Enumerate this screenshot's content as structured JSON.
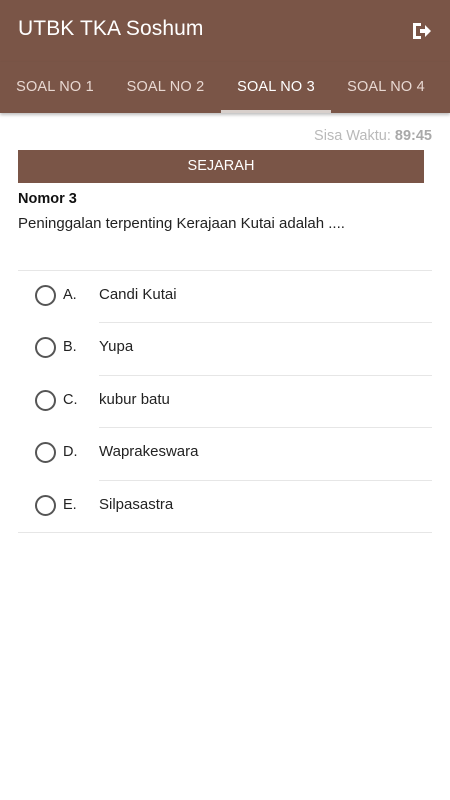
{
  "app": {
    "title": "UTBK TKA Soshum"
  },
  "icons": {
    "exit": "exit-icon"
  },
  "tabs": [
    {
      "label": "SOAL NO 1"
    },
    {
      "label": "SOAL NO 2"
    },
    {
      "label": "SOAL NO 3"
    },
    {
      "label": "SOAL NO 4"
    }
  ],
  "active_tab": "SOAL NO 3",
  "timer": {
    "label": "Sisa Waktu:",
    "value": "89:45"
  },
  "subject": "SEJARAH",
  "question": {
    "number_label": "Nomor 3",
    "text": "Peninggalan terpenting Kerajaan Kutai adalah ...."
  },
  "options": [
    {
      "letter": "A.",
      "text": "Candi Kutai"
    },
    {
      "letter": "B.",
      "text": "Yupa"
    },
    {
      "letter": "C.",
      "text": "kubur batu"
    },
    {
      "letter": "D.",
      "text": "Waprakeswara"
    },
    {
      "letter": "E.",
      "text": "Silpasastra"
    }
  ],
  "colors": {
    "primary": "#7a5547",
    "tab_indicator": "#d8d0cc"
  }
}
